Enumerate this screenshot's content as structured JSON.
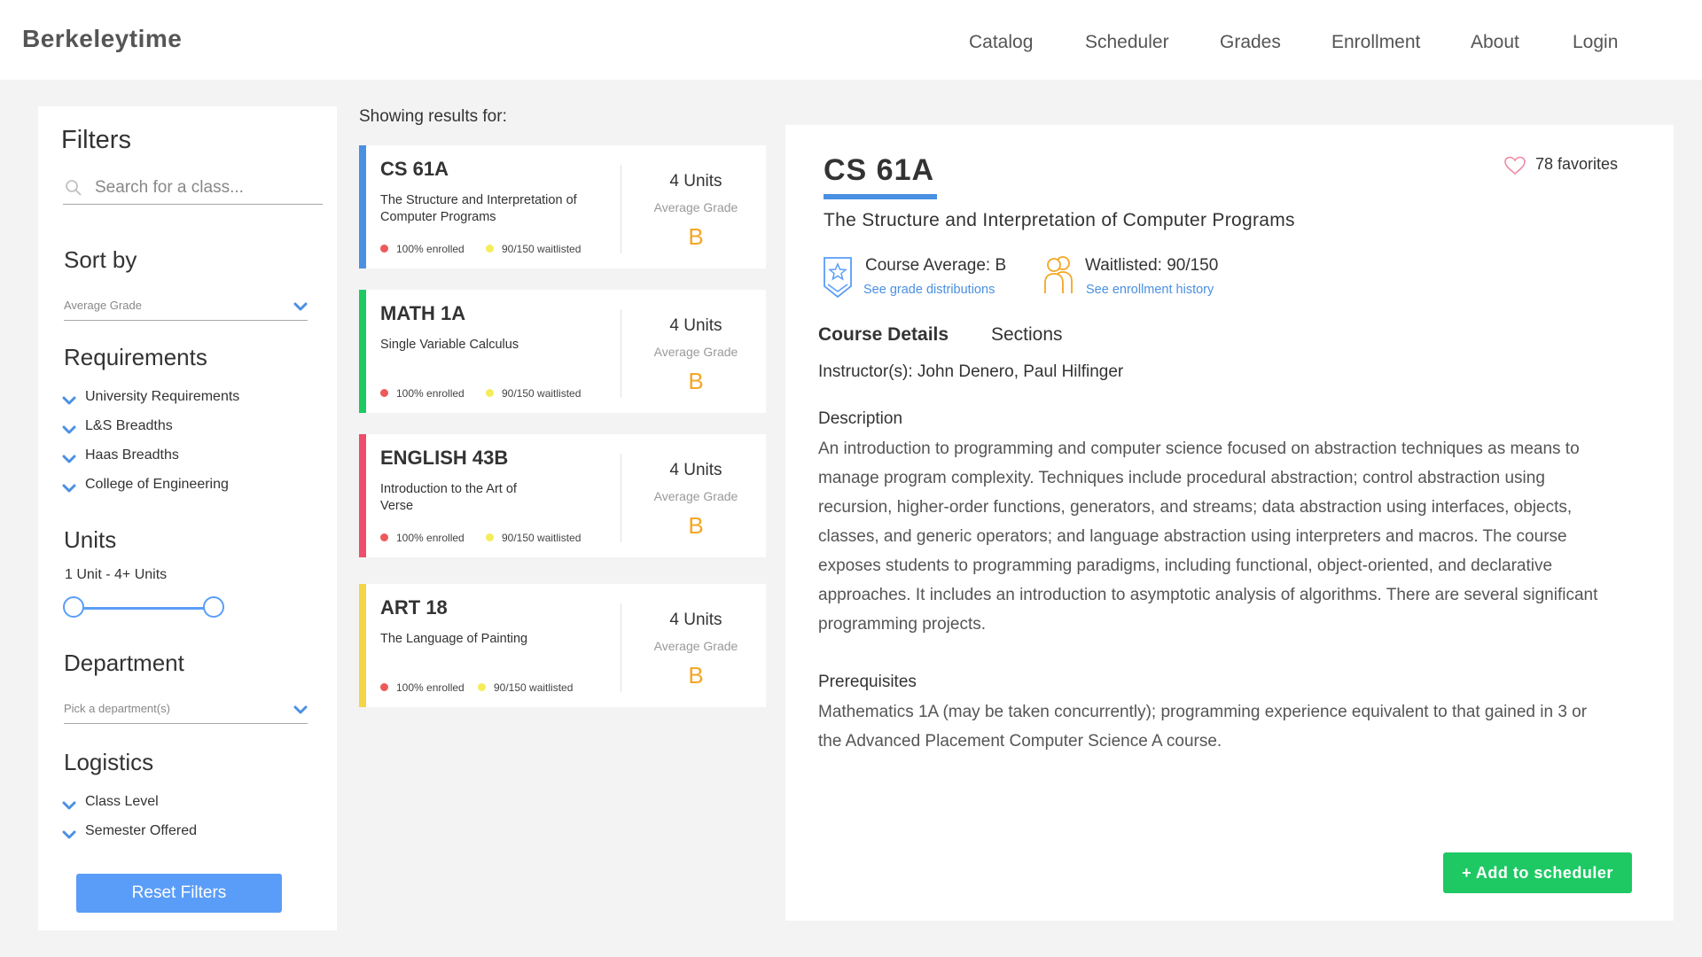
{
  "nav": {
    "brand": "Berkeleytime",
    "items": [
      "Catalog",
      "Scheduler",
      "Grades",
      "Enrollment",
      "About",
      "Login"
    ]
  },
  "filters": {
    "title": "Filters",
    "search_placeholder": "Search for a class...",
    "sort_title": "Sort by",
    "sort_value": "Average Grade",
    "requirements_title": "Requirements",
    "requirements": [
      "University Requirements",
      "L&S Breadths",
      "Haas Breadths",
      "College of Engineering"
    ],
    "units_title": "Units",
    "units_range": "1 Unit - 4+ Units",
    "units_min_fraction": 0.0,
    "units_max_fraction": 1.0,
    "department_title": "Department",
    "department_placeholder": "Pick a department(s)",
    "logistics_title": "Logistics",
    "logistics": [
      "Class Level",
      "Semester Offered"
    ],
    "reset_label": "Reset Filters"
  },
  "results": {
    "heading": "Showing results for:",
    "courses": [
      {
        "code": "CS 61A",
        "title": "The Structure and Interpretation of Computer Programs",
        "enrolled": "100% enrolled",
        "waitlisted": "90/150 waitlisted",
        "units": "4 Units",
        "avg_label": "Average Grade",
        "grade": "B",
        "color": "#4a90e2"
      },
      {
        "code": "MATH 1A",
        "title": "Single Variable Calculus",
        "enrolled": "100% enrolled",
        "waitlisted": "90/150 waitlisted",
        "units": "4 Units",
        "avg_label": "Average Grade",
        "grade": "B",
        "color": "#1ec964"
      },
      {
        "code": "ENGLISH 43B",
        "title": "Introduction to the Art of Verse",
        "enrolled": "100% enrolled",
        "waitlisted": "90/150 waitlisted",
        "units": "4 Units",
        "avg_label": "Average Grade",
        "grade": "B",
        "color": "#ee4d6b"
      },
      {
        "code": "ART 18",
        "title": "The Language of Painting",
        "enrolled": "100% enrolled",
        "waitlisted": "90/150 waitlisted",
        "units": "4 Units",
        "avg_label": "Average Grade",
        "grade": "B",
        "color": "#f5d547"
      }
    ],
    "enrolled_dot_color": "#ee5a5a",
    "waitlist_dot_color": "#f5ec5a",
    "grade_color": "#f5a623"
  },
  "detail": {
    "code": "CS 61A",
    "favorites": "78 favorites",
    "title": "The Structure and Interpretation of Computer Programs",
    "course_average": "Course Average: B",
    "grade_link": "See grade distributions",
    "waitlisted": "Waitlisted: 90/150",
    "enrollment_link": "See enrollment history",
    "tabs": [
      "Course Details",
      "Sections"
    ],
    "instructors": "Instructor(s): John Denero, Paul Hilfinger",
    "description_title": "Description",
    "description": "An introduction to programming and computer science focused on abstraction techniques as means to manage program complexity. Techniques include procedural abstraction; control abstraction using recursion, higher-order functions, generators, and streams; data abstraction using interfaces, objects, classes, and generic operators; and language abstraction using interpreters and macros. The course exposes students to programming paradigms, including functional, object-oriented, and declarative approaches. It includes an introduction to asymptotic analysis of algorithms. There are several significant programming projects.",
    "prereq_title": "Prerequisites",
    "prereqs": "Mathematics 1A (may be taken concurrently); programming experience equivalent to that gained in 3 or the Advanced Placement Computer Science A course.",
    "add_label": "+ Add to scheduler"
  }
}
